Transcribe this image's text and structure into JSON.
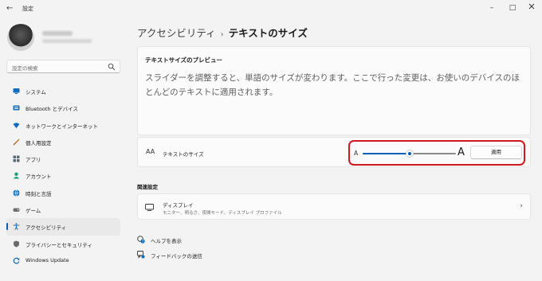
{
  "window": {
    "back": "←",
    "title": "設定",
    "minimize": "–",
    "maximize": "□"
  },
  "search": {
    "placeholder": "設定の検索"
  },
  "nav": [
    {
      "label": "システム",
      "icon": "monitor-icon"
    },
    {
      "label": "Bluetooth とデバイス",
      "icon": "bluetooth-icon"
    },
    {
      "label": "ネットワークとインターネット",
      "icon": "wifi-icon"
    },
    {
      "label": "個人用設定",
      "icon": "brush-icon"
    },
    {
      "label": "アプリ",
      "icon": "apps-icon"
    },
    {
      "label": "アカウント",
      "icon": "person-icon"
    },
    {
      "label": "時刻と言語",
      "icon": "globe-icon"
    },
    {
      "label": "ゲーム",
      "icon": "gamepad-icon"
    },
    {
      "label": "アクセシビリティ",
      "icon": "accessibility-icon",
      "active": true
    },
    {
      "label": "プライバシーとセキュリティ",
      "icon": "shield-icon"
    },
    {
      "label": "Windows Update",
      "icon": "update-icon"
    }
  ],
  "breadcrumb": {
    "parent": "アクセシビリティ",
    "separator": "›",
    "current": "テキストのサイズ"
  },
  "preview": {
    "title": "テキストサイズのプレビュー",
    "text": "スライダーを調整すると、単語のサイズが変わります。ここで行った変更は、お使いのデバイスのほとんどのテキストに適用されます。"
  },
  "text_size": {
    "icon_text": "AA",
    "label": "テキストのサイズ",
    "small_a": "A",
    "large_a": "A",
    "slider_fraction": 0.5,
    "apply": "適用"
  },
  "related": {
    "title": "関連設定",
    "display_title": "ディスプレイ",
    "display_sub": "モニター、明るさ、夜間モード、ディスプレイ プロファイル",
    "chevron": "›"
  },
  "links": {
    "help": "ヘルプを表示",
    "feedback": "フィードバックの送信"
  },
  "colors": {
    "accent": "#005fb8",
    "highlight": "#d0181f"
  }
}
